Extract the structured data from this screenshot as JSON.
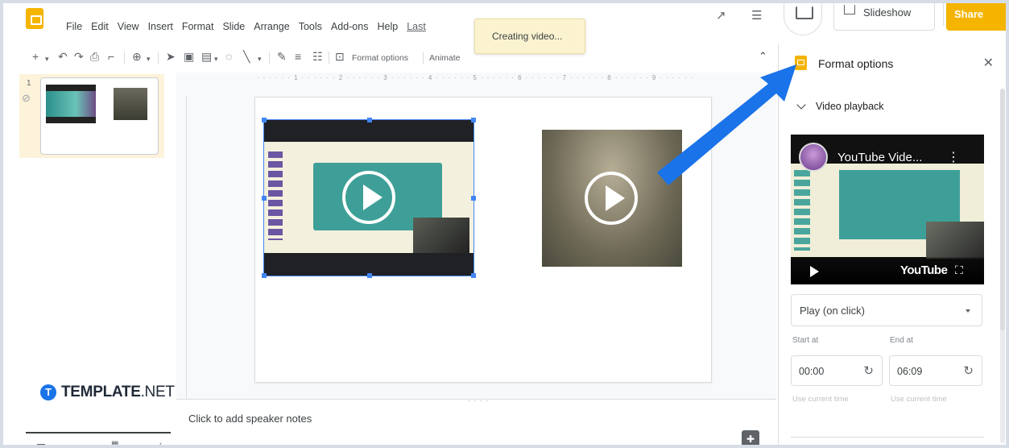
{
  "menu": {
    "items": [
      "File",
      "Edit",
      "View",
      "Insert",
      "Format",
      "Slide",
      "Arrange",
      "Tools",
      "Add-ons",
      "Help"
    ],
    "last_edit": "Last"
  },
  "toast": {
    "text": "Creating video..."
  },
  "topbar": {
    "slideshow_label": "Slideshow",
    "share_label": "Share"
  },
  "toolbar": {
    "format_options": "Format options",
    "animate": "Animate"
  },
  "filmstrip": {
    "slide_number": "1"
  },
  "canvas": {
    "ruler_marks": "· · · · · · 1 · · · · · · 2 · · · · · · 3 · · · · · · 4 · · · · · · 5 · · · · · · 6 · · · · · · 7 · · · · · · 8 · · · · · · 9 · · · · · ·"
  },
  "speaker_notes": {
    "placeholder": "Click to add speaker notes"
  },
  "watermark": {
    "brand": "TEMPLATE",
    "suffix": ".NET"
  },
  "panel": {
    "title": "Format options",
    "section": "Video playback",
    "video_title": "YouTube Vide...",
    "youtube_brand": "YouTube",
    "play_mode": "Play (on click)",
    "start_label": "Start at",
    "end_label": "End at",
    "start_value": "00:00",
    "end_value": "06:09",
    "use_current_time": "Use current time"
  },
  "colors": {
    "accent": "#f4b400",
    "selection": "#4285f4",
    "arrow": "#1a73e8"
  }
}
